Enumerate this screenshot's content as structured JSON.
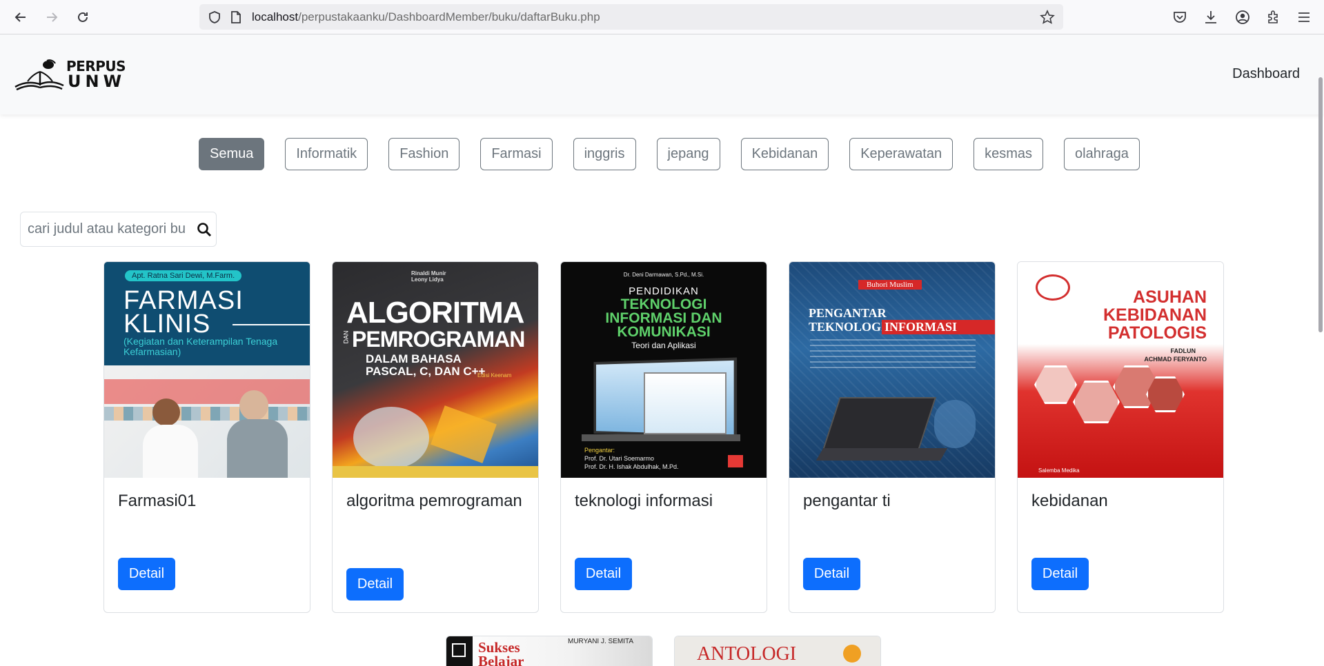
{
  "browser": {
    "url_host": "localhost",
    "url_path": "/perpustakaanku/DashboardMember/buku/daftarBuku.php",
    "icons": [
      "back-icon",
      "forward-icon",
      "reload-icon",
      "shield-icon",
      "page-icon",
      "bookmark-star-icon",
      "pocket-icon",
      "download-icon",
      "account-icon",
      "extensions-icon",
      "menu-icon"
    ]
  },
  "site": {
    "logo_top": "PERPUS",
    "logo_bottom": "UNW",
    "nav_link": "Dashboard"
  },
  "filters": [
    {
      "label": "Semua",
      "active": true
    },
    {
      "label": "Informatik",
      "active": false
    },
    {
      "label": "Fashion",
      "active": false
    },
    {
      "label": "Farmasi",
      "active": false
    },
    {
      "label": "inggris",
      "active": false
    },
    {
      "label": "jepang",
      "active": false
    },
    {
      "label": "Kebidanan",
      "active": false
    },
    {
      "label": "Keperawatan",
      "active": false
    },
    {
      "label": "kesmas",
      "active": false
    },
    {
      "label": "olahraga",
      "active": false
    }
  ],
  "search": {
    "placeholder": "cari judul atau kategori buku",
    "value": ""
  },
  "books": [
    {
      "title": "Farmasi01",
      "button": "Detail",
      "cover": {
        "author": "Apt. Ratna Sari Dewi, M.Farm.",
        "line1": "FARMASI",
        "line2": "KLINIS",
        "sub": "(Kegiatan dan Keterampilan Tenaga Kefarmasian)"
      }
    },
    {
      "title": "algoritma pemrograman",
      "button": "Detail",
      "cover": {
        "author": "Rinaldi Munir\nLeony Lidya",
        "line1": "ALGORITMA",
        "dan": "DAN",
        "line2": "PEMROGRAMAN",
        "sub1": "DALAM BAHASA",
        "sub2": "PASCAL, C, DAN C++",
        "edition": "Edisi Keenam"
      }
    },
    {
      "title": "teknologi informasi",
      "button": "Detail",
      "cover": {
        "author": "Dr. Deni Darmawan, S.Pd., M.Si.",
        "line0": "PENDIDIKAN",
        "line1": "TEKNOLOGI",
        "line2": "INFORMASI DAN",
        "line3": "KOMUNIKASI",
        "sub": "Teori dan Aplikasi",
        "foot1": "Pengantar:",
        "foot2": "Prof. Dr. Utari Soemarmo",
        "foot3": "Prof. Dr. H. Ishak Abdulhak, M.Pd."
      }
    },
    {
      "title": "pengantar ti",
      "button": "Detail",
      "cover": {
        "author": "Buhori Muslim",
        "line1": "PENGANTAR",
        "line2": "TEKNOLOGI",
        "line3": "INFORMASI"
      }
    },
    {
      "title": "kebidanan",
      "button": "Detail",
      "cover": {
        "line1": "ASUHAN",
        "line2": "KEBIDANAN",
        "line3": "PATOLOGIS",
        "author1": "FADLUN",
        "author2": "ACHMAD FERYANTO",
        "publisher": "Salemba Medika"
      }
    }
  ],
  "books_row2": [
    {
      "cover_author": "MURYANI J. SEMITA",
      "cover_title": "Sukses Belajar"
    },
    {
      "cover_title": "ANTOLOGI"
    }
  ],
  "colors": {
    "primary": "#0d6efd",
    "secondary": "#6c757d"
  }
}
